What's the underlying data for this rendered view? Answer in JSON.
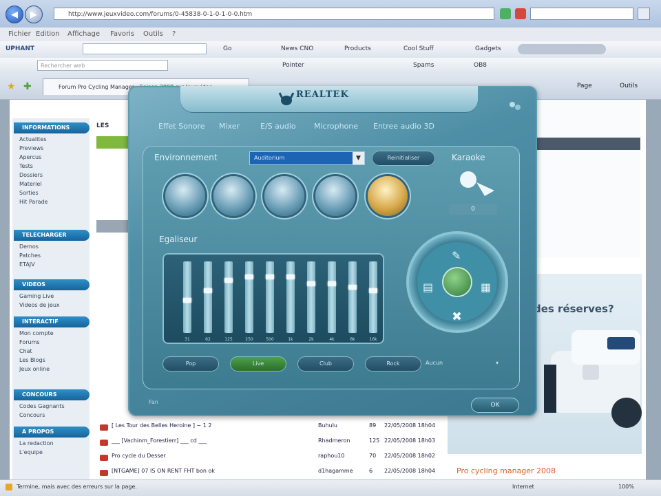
{
  "browser": {
    "address_url": "http://www.jeuxvideo.com/forums/0-45838-0-1-0-1-0-0.htm",
    "menu": [
      "Fichier",
      "Edition",
      "Affichage",
      "Favoris",
      "Outils",
      "?"
    ],
    "toolbar1": {
      "brand": "UPHANT",
      "items": [
        "Go",
        "News CNO",
        "Products",
        "Cool Stuff",
        "Gadgets"
      ]
    },
    "toolbar2": {
      "search_placeholder": "Rechercher web",
      "items": [
        "Pointer",
        "Spams",
        "OB8"
      ]
    },
    "tab_title": "Forum Pro Cycling Manager : Saison 2008 sur Jeuxvideo",
    "tab_actions": [
      "Page",
      "Outils"
    ],
    "status_text": "Termine, mais avec des erreurs sur la page.",
    "status_zone": "Internet",
    "zoom": "100%"
  },
  "webpage": {
    "sidebar_sections": [
      {
        "title": "INFORMATIONS",
        "items": [
          "Actualites",
          "Previews",
          "Apercus",
          "Tests",
          "Dossiers",
          "Materiel",
          "Sorties",
          "Hit Parade"
        ]
      },
      {
        "title": "TELECHARGER",
        "items": [
          "Demos",
          "Patches",
          "ETAJV"
        ]
      },
      {
        "title": "VIDEOS",
        "items": [
          "Gaming Live",
          "Videos de jeux"
        ]
      },
      {
        "title": "INTERACTIF",
        "items": [
          "Mon compte",
          "Forums",
          "Chat",
          "Les Blogs",
          "Jeux online"
        ]
      },
      {
        "title": "CONCOURS",
        "items": [
          "Codes Gagnants",
          "Concours"
        ]
      },
      {
        "title": "A PROPOS",
        "items": [
          "La redaction",
          "L'equipe"
        ]
      }
    ],
    "list_rows": [
      {
        "title": "[ Les Tour des Belles Heroine ] ~ 1 2",
        "author": "Buhulu",
        "count": "89",
        "date": "22/05/2008 18h04"
      },
      {
        "title": "___ [Vachinm_Forestierr] ___ cd ___",
        "author": "Rhadmeron",
        "count": "125",
        "date": "22/05/2008 18h03"
      },
      {
        "title": "Pro cycle du Desser",
        "author": "raphou10",
        "count": "70",
        "date": "22/05/2008 18h02"
      },
      {
        "title": "[NTGAME] 07 IS ON RENT FHT bon ok",
        "author": "d1hagamme",
        "count": "6",
        "date": "22/05/2008 18h04"
      }
    ],
    "banner_text": "des réserves?",
    "footer_promo": "Pro cycling manager 2008"
  },
  "dialog": {
    "logo": "REALTEK",
    "tabs": [
      "Effet Sonore",
      "Mixer",
      "E/S audio",
      "Microphone",
      "Entree audio 3D"
    ],
    "environment_label": "Environnement",
    "environment_value": "Auditorium",
    "reset_label": "Reinitialiser",
    "karaoke_label": "Karaoke",
    "karaoke_value": "0",
    "equalizer_label": "Egaliseur",
    "eq_frequencies": [
      "31",
      "62",
      "125",
      "250",
      "500",
      "1k",
      "2k",
      "4k",
      "8k",
      "16k"
    ],
    "eq_levels": [
      0.45,
      0.6,
      0.75,
      0.8,
      0.8,
      0.8,
      0.7,
      0.7,
      0.65,
      0.6
    ],
    "eq_presets": [
      "Pop",
      "Live",
      "Club",
      "Rock"
    ],
    "eq_dropdown": "Aucun",
    "footer_left": "Fan",
    "ok_label": "OK"
  },
  "colors": {
    "dialog_base": "#3c788f",
    "dialog_light": "#7fb3c6",
    "accent_gold": "#d7a84a",
    "select_blue": "#1d64b5",
    "banner_text": "#3a5267"
  }
}
